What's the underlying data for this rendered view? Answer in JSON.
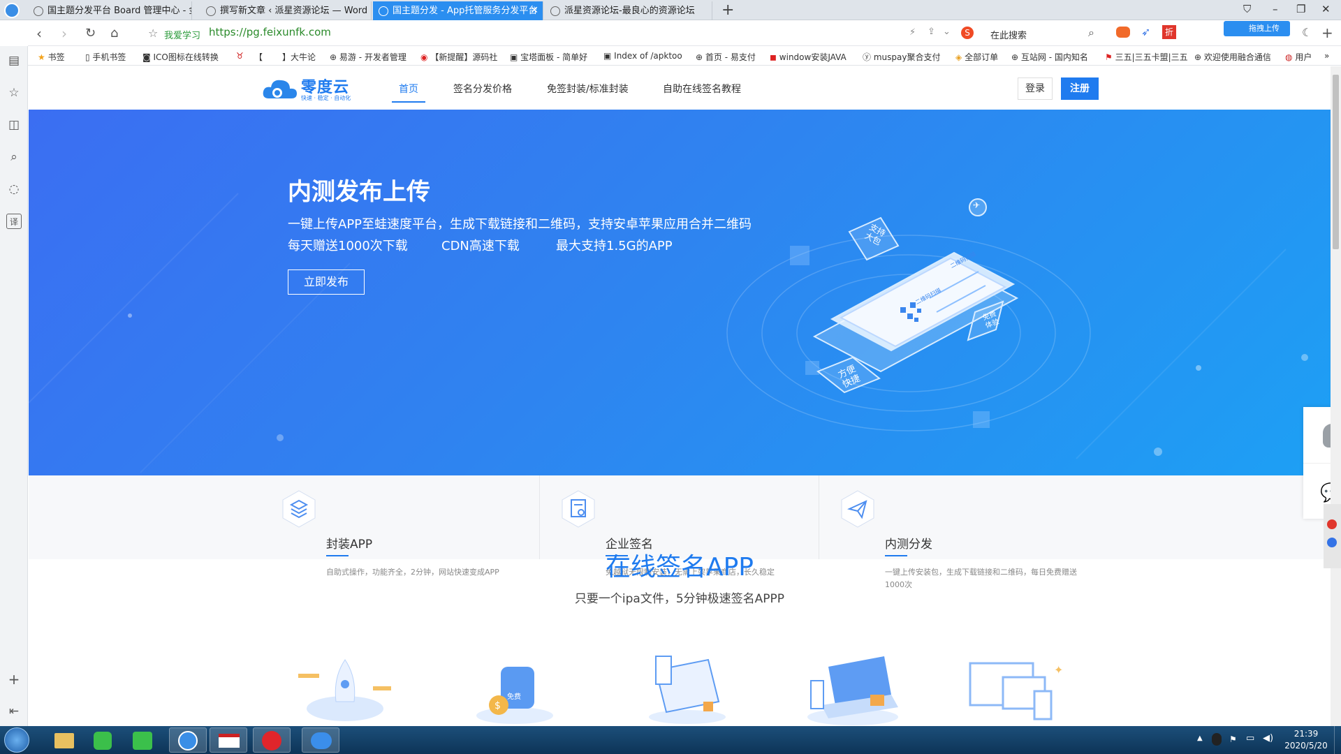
{
  "browser": {
    "tabs": [
      {
        "label": "国主题分发平台 Board 管理中心 - 金"
      },
      {
        "label": "撰写新文章 ‹ 派星资源论坛 — Word"
      },
      {
        "label": "国主题分发 - App托管服务分发平台"
      },
      {
        "label": "派星资源论坛-最良心的资源论坛"
      }
    ],
    "address": {
      "prefix_label": "我爱学习",
      "url": "https://pg.feixunfk.com"
    },
    "search": {
      "placeholder": "在此搜索"
    },
    "upload_label": "拖拽上传",
    "bookmarks": [
      "书签",
      "手机书签",
      "ICO图标在线转换",
      "【",
      "】大牛论",
      "易游 - 开发者管理",
      "【新提醒】源码社",
      "宝塔面板 - 简单好",
      "Index of /apktoo",
      "首页 - 易支付",
      "window安装JAVA",
      "muspay聚合支付",
      "全部订单",
      "互站网 - 国内知名",
      "三五|三五卡盟|三五",
      "欢迎使用融合通信",
      "用户"
    ]
  },
  "site": {
    "logo": {
      "name": "零度云",
      "tagline": "快速 · 稳定 · 自动化"
    },
    "nav": [
      "首页",
      "签名分发价格",
      "免签封装/标准封装",
      "自助在线签名教程"
    ],
    "login_label": "登录",
    "register_label": "注册",
    "hero": {
      "title": "内测发布上传",
      "desc": "一键上传APP至蛙速度平台，生成下载链接和二维码，支持安卓苹果应用合并二维码",
      "feat1": "每天赠送1000次下载",
      "feat2": "CDN高速下载",
      "feat3": "最大支持1.5G的APP",
      "button": "立即发布",
      "phone_labels": {
        "tag1": "支持\n大包",
        "tag2": "免费\n体验",
        "tag3": "方便\n快捷",
        "screen1": "二维码扫描",
        "screen2": "二维码扫描"
      }
    },
    "features": [
      {
        "title": "封装APP",
        "desc": "自助式操作，功能齐全，2分钟，网站快速变成APP"
      },
      {
        "title": "企业签名",
        "desc": "免越狱无限制安装，无需上架苹果商店，长久稳定"
      },
      {
        "title": "内测分发",
        "desc": "一键上传安装包，生成下载链接和二维码，每日免费赠送1000次"
      }
    ],
    "section_title": "在线签名APP",
    "section_sub": "只要一个ipa文件，5分钟极速签名APPP",
    "illus_free_label": "免费"
  },
  "taskbar": {
    "time": "21:39",
    "date": "2020/5/20"
  },
  "colors": {
    "accent": "#1f7bef",
    "hero_start": "#3b6ef2",
    "hero_end": "#1da0f4"
  }
}
